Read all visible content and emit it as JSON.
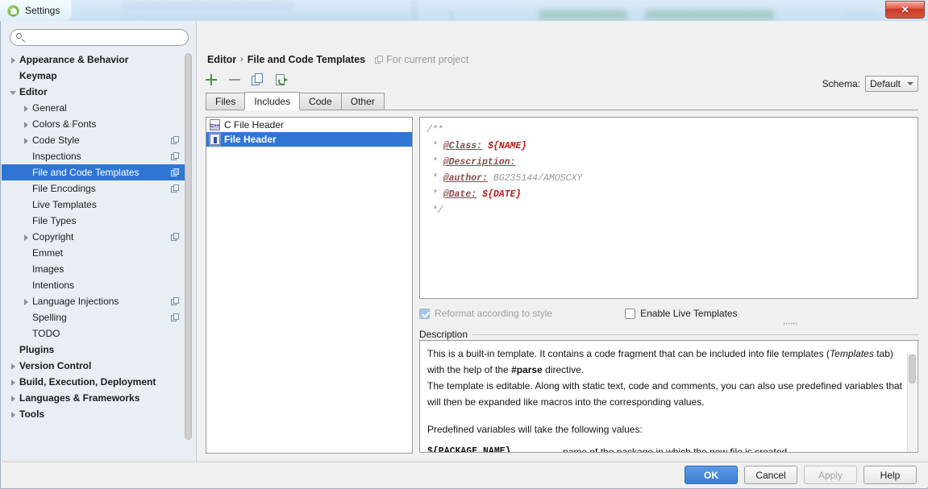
{
  "window": {
    "title": "Settings",
    "app_icon": "android-studio-icon",
    "close_label": "✕"
  },
  "search": {
    "value": "",
    "placeholder": "",
    "icon": "search-icon"
  },
  "sidebar": {
    "items": [
      {
        "label": "Appearance & Behavior",
        "arrow": "closed",
        "indent": 0,
        "bold": true,
        "badge": false,
        "selected": false
      },
      {
        "label": "Keymap",
        "arrow": "none",
        "indent": 0,
        "bold": true,
        "badge": false,
        "selected": false
      },
      {
        "label": "Editor",
        "arrow": "open",
        "indent": 0,
        "bold": true,
        "badge": false,
        "selected": false
      },
      {
        "label": "General",
        "arrow": "closed",
        "indent": 1,
        "bold": false,
        "badge": false,
        "selected": false
      },
      {
        "label": "Colors & Fonts",
        "arrow": "closed",
        "indent": 1,
        "bold": false,
        "badge": false,
        "selected": false
      },
      {
        "label": "Code Style",
        "arrow": "closed",
        "indent": 1,
        "bold": false,
        "badge": true,
        "selected": false
      },
      {
        "label": "Inspections",
        "arrow": "none",
        "indent": 1,
        "bold": false,
        "badge": true,
        "selected": false
      },
      {
        "label": "File and Code Templates",
        "arrow": "none",
        "indent": 1,
        "bold": false,
        "badge": true,
        "selected": true
      },
      {
        "label": "File Encodings",
        "arrow": "none",
        "indent": 1,
        "bold": false,
        "badge": true,
        "selected": false
      },
      {
        "label": "Live Templates",
        "arrow": "none",
        "indent": 1,
        "bold": false,
        "badge": false,
        "selected": false
      },
      {
        "label": "File Types",
        "arrow": "none",
        "indent": 1,
        "bold": false,
        "badge": false,
        "selected": false
      },
      {
        "label": "Copyright",
        "arrow": "closed",
        "indent": 1,
        "bold": false,
        "badge": true,
        "selected": false
      },
      {
        "label": "Emmet",
        "arrow": "none",
        "indent": 1,
        "bold": false,
        "badge": false,
        "selected": false
      },
      {
        "label": "Images",
        "arrow": "none",
        "indent": 1,
        "bold": false,
        "badge": false,
        "selected": false
      },
      {
        "label": "Intentions",
        "arrow": "none",
        "indent": 1,
        "bold": false,
        "badge": false,
        "selected": false
      },
      {
        "label": "Language Injections",
        "arrow": "closed",
        "indent": 1,
        "bold": false,
        "badge": true,
        "selected": false
      },
      {
        "label": "Spelling",
        "arrow": "none",
        "indent": 1,
        "bold": false,
        "badge": true,
        "selected": false
      },
      {
        "label": "TODO",
        "arrow": "none",
        "indent": 1,
        "bold": false,
        "badge": false,
        "selected": false
      },
      {
        "label": "Plugins",
        "arrow": "none",
        "indent": 0,
        "bold": true,
        "badge": false,
        "selected": false
      },
      {
        "label": "Version Control",
        "arrow": "closed",
        "indent": 0,
        "bold": true,
        "badge": false,
        "selected": false
      },
      {
        "label": "Build, Execution, Deployment",
        "arrow": "closed",
        "indent": 0,
        "bold": true,
        "badge": false,
        "selected": false
      },
      {
        "label": "Languages & Frameworks",
        "arrow": "closed",
        "indent": 0,
        "bold": true,
        "badge": false,
        "selected": false
      },
      {
        "label": "Tools",
        "arrow": "closed",
        "indent": 0,
        "bold": true,
        "badge": false,
        "selected": false
      }
    ]
  },
  "breadcrumb": {
    "parent": "Editor",
    "separator": "›",
    "current": "File and Code Templates",
    "scope_note": "For current project",
    "scope_icon": "project-scope-icon"
  },
  "toolbar": {
    "add_label": "+",
    "remove_label": "−",
    "copy_label": "copy",
    "reset_label": "reset"
  },
  "schema": {
    "label": "Schema:",
    "value": "Default"
  },
  "tabs": [
    {
      "label": "Files",
      "active": false
    },
    {
      "label": "Includes",
      "active": true
    },
    {
      "label": "Code",
      "active": false
    },
    {
      "label": "Other",
      "active": false
    }
  ],
  "template_list": [
    {
      "label": "C File Header",
      "icon": "cpp-file-icon",
      "selected": false
    },
    {
      "label": "File Header",
      "icon": "file-icon",
      "selected": true
    }
  ],
  "editor": {
    "lines": [
      {
        "parts": [
          {
            "text": "/**",
            "style": "comment"
          }
        ]
      },
      {
        "parts": [
          {
            "text": " * ",
            "style": "comment"
          },
          {
            "text": "@Class:",
            "style": "tag"
          },
          {
            "text": " ",
            "style": "plain"
          },
          {
            "text": "${NAME}",
            "style": "var"
          }
        ]
      },
      {
        "parts": [
          {
            "text": " * ",
            "style": "comment"
          },
          {
            "text": "@Description:",
            "style": "tag"
          }
        ]
      },
      {
        "parts": [
          {
            "text": " * ",
            "style": "comment"
          },
          {
            "text": "@author:",
            "style": "tag"
          },
          {
            "text": " BG235144/AMOSCXY",
            "style": "plain"
          }
        ]
      },
      {
        "parts": [
          {
            "text": " * ",
            "style": "comment"
          },
          {
            "text": "@Date:",
            "style": "tag"
          },
          {
            "text": " ",
            "style": "plain"
          },
          {
            "text": "${DATE}",
            "style": "var"
          }
        ]
      },
      {
        "parts": [
          {
            "text": " */",
            "style": "comment"
          }
        ]
      }
    ]
  },
  "options": {
    "reformat": {
      "label": "Reformat according to style",
      "checked": true,
      "disabled": true
    },
    "live_templates": {
      "label": "Enable Live Templates",
      "checked": false,
      "disabled": false
    }
  },
  "description": {
    "legend": "Description",
    "paragraph1_a": "This is a built-in template. It contains a code fragment that can be included into file templates (",
    "paragraph1_italic": "Templates",
    "paragraph1_b": " tab) with the help of the ",
    "paragraph1_bold": "#parse",
    "paragraph1_c": " directive.",
    "paragraph2": "The template is editable. Along with static text, code and comments, you can also use predefined variables that will then be expanded like macros into the corresponding values.",
    "paragraph3": "Predefined variables will take the following values:",
    "variables": [
      {
        "name": "${PACKAGE_NAME}",
        "desc": "name of the package in which the new file is created"
      }
    ]
  },
  "footer": {
    "ok": "OK",
    "cancel": "Cancel",
    "apply": "Apply",
    "help": "Help"
  },
  "colors": {
    "selection": "#2f75d4",
    "primary_button": "#3d7fd1",
    "accent_green": "#3d9a3d",
    "code_variable": "#b81e1e"
  }
}
